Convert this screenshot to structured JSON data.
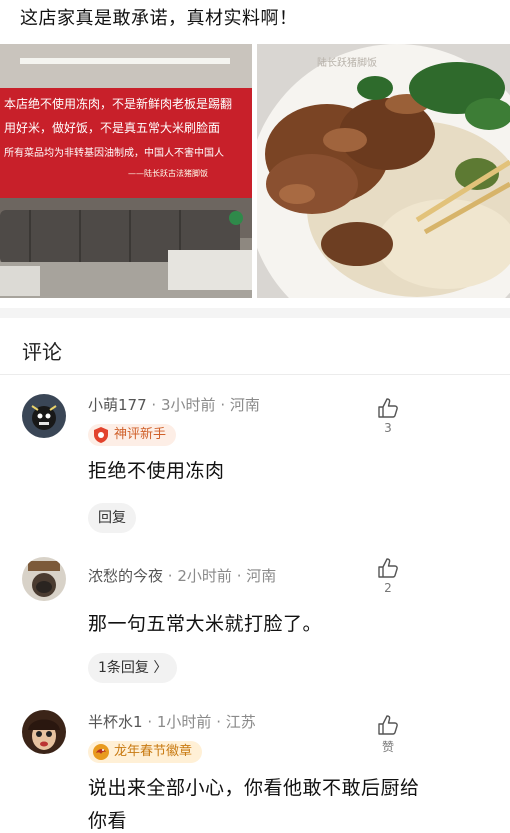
{
  "post": {
    "text": "这店家真是敢承诺，真材实料啊！"
  },
  "photos": {
    "left": {
      "banner_line1": "本店绝不使用冻肉，不是新鲜肉老板是踢翻",
      "banner_line2": "用好米，做好饭，不是真五常大米刷脸面",
      "banner_line3": "所有菜品均为非转基因油制成，中国人不害中国人",
      "banner_sign": "——陆长跃古法猪脚饭",
      "banner_color": "#c8202a"
    },
    "right": {
      "bowl_text": "陆长跃猪脚饭"
    }
  },
  "comments_section": {
    "title": "评论"
  },
  "comments": [
    {
      "username": "小萌177",
      "time": "3小时前",
      "location": "河南",
      "badge": "神评新手",
      "text": "拒绝不使用冻肉",
      "reply_label": "回复",
      "likes": "3"
    },
    {
      "username": "浓愁的今夜",
      "time": "2小时前",
      "location": "河南",
      "text": "那一句五常大米就打脸了。",
      "reply_label": "1条回复 〉",
      "likes": "2"
    },
    {
      "username": "半杯水1",
      "time": "1小时前",
      "location": "江苏",
      "badge": "龙年春节徽章",
      "text_line1": "说出来全部小心，你看他敢不敢后厨给",
      "text_line2": "你看",
      "likes": "赞"
    }
  ],
  "meta_separator": "·",
  "colors": {
    "accent_red": "#e85a3c",
    "badge_orange": "#c87a12",
    "muted": "#8a8a8a"
  },
  "icons": [
    "thumbs-up-icon",
    "shield-badge-icon",
    "dragon-badge-icon"
  ]
}
